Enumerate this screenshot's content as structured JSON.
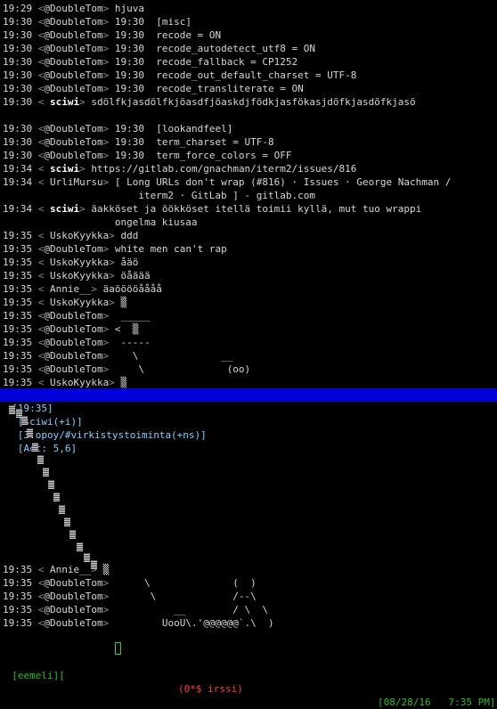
{
  "chat": {
    "lines": [
      {
        "ts": "19:29",
        "nick": "@DoubleTom",
        "text": "hjuva",
        "kind": "me"
      },
      {
        "ts": "19:30",
        "nick": "@DoubleTom",
        "text": "19:30  [misc]",
        "kind": "me"
      },
      {
        "ts": "19:30",
        "nick": "@DoubleTom",
        "text": "19:30  recode = ON",
        "kind": "me"
      },
      {
        "ts": "19:30",
        "nick": "@DoubleTom",
        "text": "19:30  recode_autodetect_utf8 = ON",
        "kind": "me"
      },
      {
        "ts": "19:30",
        "nick": "@DoubleTom",
        "text": "19:30  recode_fallback = CP1252",
        "kind": "me"
      },
      {
        "ts": "19:30",
        "nick": "@DoubleTom",
        "text": "19:30  recode_out_default_charset = UTF-8",
        "kind": "me"
      },
      {
        "ts": "19:30",
        "nick": "@DoubleTom",
        "text": "19:30  recode_transliterate = ON",
        "kind": "me"
      },
      {
        "ts": "19:30",
        "nick": " sciwi",
        "text": "sdölfkjasdölfkjöasdfjöaskdjfödkjasfökasjdöfkjasdöfkjasö",
        "kind": "bold"
      },
      {
        "ts": "",
        "nick": "",
        "text": "",
        "kind": "blank"
      },
      {
        "ts": "19:30",
        "nick": "@DoubleTom",
        "text": "19:30  [lookandfeel]",
        "kind": "me"
      },
      {
        "ts": "19:30",
        "nick": "@DoubleTom",
        "text": "19:30  term_charset = UTF-8",
        "kind": "me"
      },
      {
        "ts": "19:30",
        "nick": "@DoubleTom",
        "text": "19:30  term_force_colors = OFF",
        "kind": "me"
      },
      {
        "ts": "19:34",
        "nick": " sciwi",
        "text": "https://gitlab.com/gnachman/iterm2/issues/816",
        "kind": "bold"
      },
      {
        "ts": "19:34",
        "nick": " UrliMursu",
        "text": "[ Long URLs don't wrap (#816) · Issues · George Nachman /",
        "kind": "other"
      },
      {
        "ts": "",
        "nick": "",
        "text": "                       iterm2 · GitLab ] - gitlab.com",
        "kind": "cont"
      },
      {
        "ts": "19:34",
        "nick": " sciwi",
        "text": "äakköset ja öökköset itellä toimii kyllä, mut tuo wrappi",
        "kind": "bold"
      },
      {
        "ts": "",
        "nick": "",
        "text": "                   ongelma kiusaa",
        "kind": "cont"
      },
      {
        "ts": "19:35",
        "nick": " UskoKyykka",
        "text": "ddd",
        "kind": "other"
      },
      {
        "ts": "19:35",
        "nick": "@DoubleTom",
        "text": "white men can't rap",
        "kind": "me"
      },
      {
        "ts": "19:35",
        "nick": " UskoKyykka",
        "text": "åäö",
        "kind": "other"
      },
      {
        "ts": "19:35",
        "nick": " UskoKyykka",
        "text": "öåäää",
        "kind": "other"
      },
      {
        "ts": "19:35",
        "nick": " Annie__",
        "text": "äaööööåååå",
        "kind": "other"
      },
      {
        "ts": "19:35",
        "nick": " UskoKyykka",
        "text": "▒",
        "kind": "other"
      },
      {
        "ts": "19:35",
        "nick": "@DoubleTom",
        "text": " _____",
        "kind": "me"
      },
      {
        "ts": "19:35",
        "nick": "@DoubleTom",
        "text": "<  ▒",
        "kind": "me"
      },
      {
        "ts": "19:35",
        "nick": "@DoubleTom",
        "text": " -----",
        "kind": "me"
      },
      {
        "ts": "19:35",
        "nick": "@DoubleTom",
        "text": "   \\              __",
        "kind": "me"
      },
      {
        "ts": "19:35",
        "nick": "@DoubleTom",
        "text": "    \\              (oo)",
        "kind": "me"
      },
      {
        "ts": "19:35",
        "nick": " UskoKyykka",
        "text": "▒",
        "kind": "other"
      }
    ],
    "lower_lines": [
      {
        "ts": "19:35",
        "nick": " Annie__",
        "text": "▒",
        "kind": "other"
      },
      {
        "ts": "19:35",
        "nick": "@DoubleTom",
        "text": "     \\              (  )",
        "kind": "me"
      },
      {
        "ts": "19:35",
        "nick": "@DoubleTom",
        "text": "      \\             /--\\",
        "kind": "me"
      },
      {
        "ts": "19:35",
        "nick": "@DoubleTom",
        "text": "          __        / \\  \\",
        "kind": "me"
      },
      {
        "ts": "19:35",
        "nick": "@DoubleTom",
        "text": "        UooU\\.'@@@@@@`.\\  )",
        "kind": "me"
      }
    ]
  },
  "status_bar": {
    "time": "[19:35]",
    "nick": "[sciwi(+i)]",
    "channel": "[3:opoy/#virkistystoiminta(+ns)]",
    "act_label": "[Act: 5,6]"
  },
  "tmux": {
    "session": "[eemeli][",
    "window": "(0*$ irssi)",
    "datetime": "[08/28/16   7:35 PM]"
  },
  "colors": {
    "background": "#000000",
    "status_bg": "#0000d8",
    "status_fg": "#7fd0ff",
    "tmux_green": "#2fb82f",
    "tmux_red": "#ff3838"
  }
}
